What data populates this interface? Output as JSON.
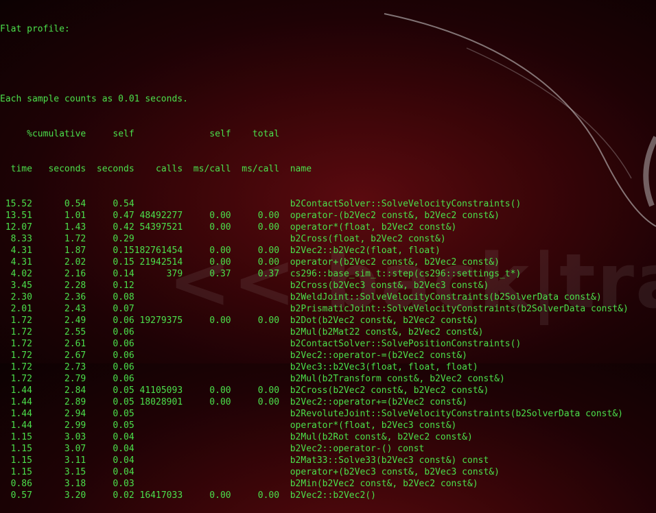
{
  "background": {
    "watermark_text": "<< back|track",
    "colors": {
      "background": "#3a0508",
      "text": "#4be04b"
    }
  },
  "terminal": {
    "title": "Flat profile:",
    "note": "Each sample counts as 0.01 seconds.",
    "header1": {
      "pct": " %",
      "cumulative": "cumulative",
      "self": "self",
      "selfcall": "self",
      "totalcall": "total",
      "name": ""
    },
    "header2": {
      "pct": "time",
      "cumulative": "seconds",
      "self": "seconds",
      "calls": "calls",
      "selfcall": "ms/call",
      "totalcall": "ms/call",
      "name": "name"
    },
    "rows": [
      {
        "pct": "15.52",
        "cum": "0.54",
        "self": "0.54",
        "calls": "",
        "selfcall": "",
        "totalcall": "",
        "name": "b2ContactSolver::SolveVelocityConstraints()"
      },
      {
        "pct": "13.51",
        "cum": "1.01",
        "self": "0.47",
        "calls": "48492277",
        "selfcall": "0.00",
        "totalcall": "0.00",
        "name": "operator-(b2Vec2 const&, b2Vec2 const&)"
      },
      {
        "pct": "12.07",
        "cum": "1.43",
        "self": "0.42",
        "calls": "54397521",
        "selfcall": "0.00",
        "totalcall": "0.00",
        "name": "operator*(float, b2Vec2 const&)"
      },
      {
        "pct": "8.33",
        "cum": "1.72",
        "self": "0.29",
        "calls": "",
        "selfcall": "",
        "totalcall": "",
        "name": "b2Cross(float, b2Vec2 const&)"
      },
      {
        "pct": "4.31",
        "cum": "1.87",
        "self": "0.15",
        "calls": "182761454",
        "selfcall": "0.00",
        "totalcall": "0.00",
        "name": "b2Vec2::b2Vec2(float, float)"
      },
      {
        "pct": "4.31",
        "cum": "2.02",
        "self": "0.15",
        "calls": "21942514",
        "selfcall": "0.00",
        "totalcall": "0.00",
        "name": "operator+(b2Vec2 const&, b2Vec2 const&)"
      },
      {
        "pct": "4.02",
        "cum": "2.16",
        "self": "0.14",
        "calls": "379",
        "selfcall": "0.37",
        "totalcall": "0.37",
        "name": "cs296::base_sim_t::step(cs296::settings_t*)"
      },
      {
        "pct": "3.45",
        "cum": "2.28",
        "self": "0.12",
        "calls": "",
        "selfcall": "",
        "totalcall": "",
        "name": "b2Cross(b2Vec3 const&, b2Vec3 const&)"
      },
      {
        "pct": "2.30",
        "cum": "2.36",
        "self": "0.08",
        "calls": "",
        "selfcall": "",
        "totalcall": "",
        "name": "b2WeldJoint::SolveVelocityConstraints(b2SolverData const&)"
      },
      {
        "pct": "2.01",
        "cum": "2.43",
        "self": "0.07",
        "calls": "",
        "selfcall": "",
        "totalcall": "",
        "name": "b2PrismaticJoint::SolveVelocityConstraints(b2SolverData const&)"
      },
      {
        "pct": "1.72",
        "cum": "2.49",
        "self": "0.06",
        "calls": "19279375",
        "selfcall": "0.00",
        "totalcall": "0.00",
        "name": "b2Dot(b2Vec2 const&, b2Vec2 const&)"
      },
      {
        "pct": "1.72",
        "cum": "2.55",
        "self": "0.06",
        "calls": "",
        "selfcall": "",
        "totalcall": "",
        "name": "b2Mul(b2Mat22 const&, b2Vec2 const&)"
      },
      {
        "pct": "1.72",
        "cum": "2.61",
        "self": "0.06",
        "calls": "",
        "selfcall": "",
        "totalcall": "",
        "name": "b2ContactSolver::SolvePositionConstraints()"
      },
      {
        "pct": "1.72",
        "cum": "2.67",
        "self": "0.06",
        "calls": "",
        "selfcall": "",
        "totalcall": "",
        "name": "b2Vec2::operator-=(b2Vec2 const&)"
      },
      {
        "pct": "1.72",
        "cum": "2.73",
        "self": "0.06",
        "calls": "",
        "selfcall": "",
        "totalcall": "",
        "name": "b2Vec3::b2Vec3(float, float, float)"
      },
      {
        "pct": "1.72",
        "cum": "2.79",
        "self": "0.06",
        "calls": "",
        "selfcall": "",
        "totalcall": "",
        "name": "b2Mul(b2Transform const&, b2Vec2 const&)"
      },
      {
        "pct": "1.44",
        "cum": "2.84",
        "self": "0.05",
        "calls": "41105093",
        "selfcall": "0.00",
        "totalcall": "0.00",
        "name": "b2Cross(b2Vec2 const&, b2Vec2 const&)"
      },
      {
        "pct": "1.44",
        "cum": "2.89",
        "self": "0.05",
        "calls": "18028901",
        "selfcall": "0.00",
        "totalcall": "0.00",
        "name": "b2Vec2::operator+=(b2Vec2 const&)"
      },
      {
        "pct": "1.44",
        "cum": "2.94",
        "self": "0.05",
        "calls": "",
        "selfcall": "",
        "totalcall": "",
        "name": "b2RevoluteJoint::SolveVelocityConstraints(b2SolverData const&)"
      },
      {
        "pct": "1.44",
        "cum": "2.99",
        "self": "0.05",
        "calls": "",
        "selfcall": "",
        "totalcall": "",
        "name": "operator*(float, b2Vec3 const&)"
      },
      {
        "pct": "1.15",
        "cum": "3.03",
        "self": "0.04",
        "calls": "",
        "selfcall": "",
        "totalcall": "",
        "name": "b2Mul(b2Rot const&, b2Vec2 const&)"
      },
      {
        "pct": "1.15",
        "cum": "3.07",
        "self": "0.04",
        "calls": "",
        "selfcall": "",
        "totalcall": "",
        "name": "b2Vec2::operator-() const"
      },
      {
        "pct": "1.15",
        "cum": "3.11",
        "self": "0.04",
        "calls": "",
        "selfcall": "",
        "totalcall": "",
        "name": "b2Mat33::Solve33(b2Vec3 const&) const"
      },
      {
        "pct": "1.15",
        "cum": "3.15",
        "self": "0.04",
        "calls": "",
        "selfcall": "",
        "totalcall": "",
        "name": "operator+(b2Vec3 const&, b2Vec3 const&)"
      },
      {
        "pct": "0.86",
        "cum": "3.18",
        "self": "0.03",
        "calls": "",
        "selfcall": "",
        "totalcall": "",
        "name": "b2Min(b2Vec2 const&, b2Vec2 const&)"
      },
      {
        "pct": "0.57",
        "cum": "3.20",
        "self": "0.02",
        "calls": "16417033",
        "selfcall": "0.00",
        "totalcall": "0.00",
        "name": "b2Vec2::b2Vec2()"
      }
    ]
  }
}
